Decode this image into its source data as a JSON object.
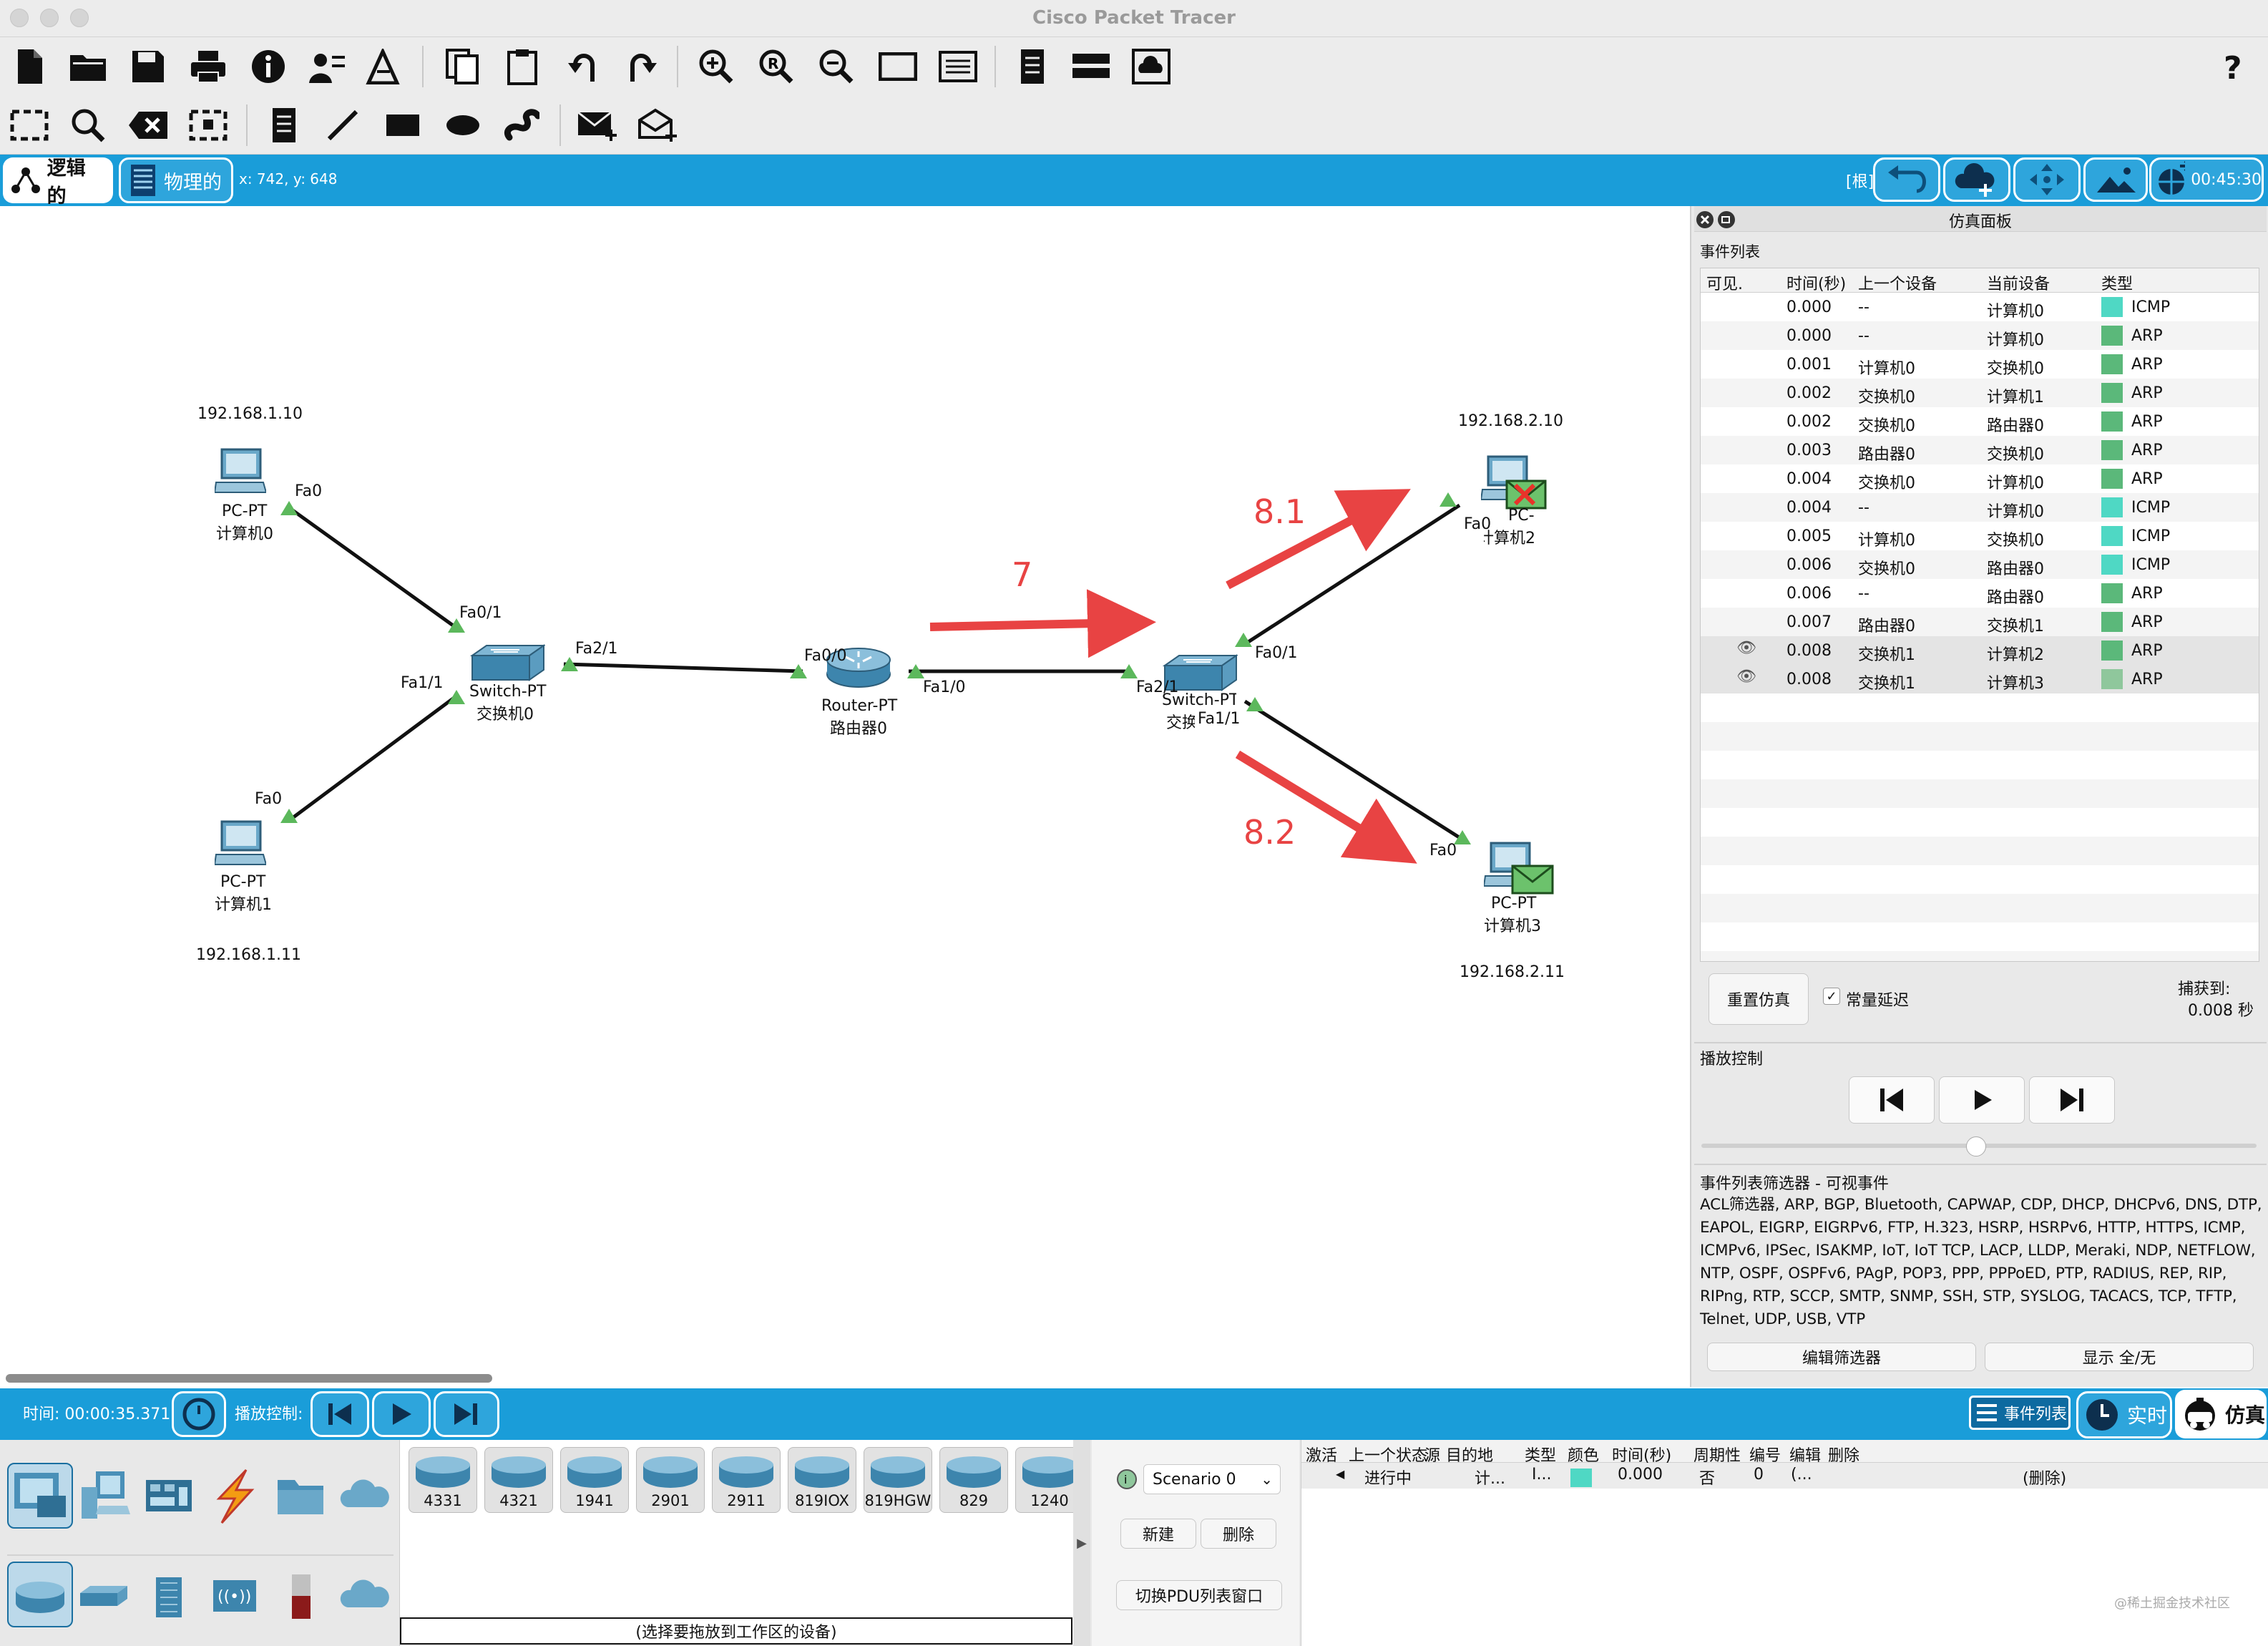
{
  "window": {
    "title": "Cisco Packet Tracer"
  },
  "tabs": {
    "logical": "逻辑的",
    "physical": "物理的",
    "coords": "x: 742, y: 648"
  },
  "topbar": {
    "root": "[根]",
    "clock": "00:45:30"
  },
  "topology": {
    "pc0": {
      "model": "PC-PT",
      "name": "计算机0",
      "ip": "192.168.1.10",
      "port": "Fa0"
    },
    "pc1": {
      "model": "PC-PT",
      "name": "计算机1",
      "ip": "192.168.1.11",
      "port": "Fa0"
    },
    "pc2": {
      "model": "PC-PT",
      "name": "计算机2",
      "ip": "192.168.2.10",
      "port": "Fa0"
    },
    "pc3": {
      "model": "PC-PT",
      "name": "计算机3",
      "ip": "192.168.2.11",
      "port": "Fa0"
    },
    "switch0": {
      "model": "Switch-PT",
      "name": "交换机0",
      "ports": [
        "Fa0/1",
        "Fa1/1",
        "Fa2/1"
      ]
    },
    "router0": {
      "model": "Router-PT",
      "name": "路由器0",
      "ports": [
        "Fa0/0",
        "Fa1/0"
      ]
    },
    "switch1": {
      "model": "Switch-PT",
      "name": "交换机1",
      "ports": [
        "Fa2/1",
        "Fa0/1",
        "Fa1/1"
      ]
    },
    "annotations": [
      "7",
      "8.1",
      "8.2"
    ]
  },
  "sim_panel": {
    "title": "仿真面板",
    "event_list_label": "事件列表",
    "headers": [
      "可见.",
      "时间(秒)",
      "上一个设备",
      "当前设备",
      "类型"
    ],
    "rows": [
      {
        "time": "0.000",
        "prev": "--",
        "cur": "计算机0",
        "type": "ICMP",
        "color": "#4fd8c4",
        "eye": false
      },
      {
        "time": "0.000",
        "prev": "--",
        "cur": "计算机0",
        "type": "ARP",
        "color": "#5bb87a",
        "eye": false
      },
      {
        "time": "0.001",
        "prev": "计算机0",
        "cur": "交换机0",
        "type": "ARP",
        "color": "#5bb87a",
        "eye": false
      },
      {
        "time": "0.002",
        "prev": "交换机0",
        "cur": "计算机1",
        "type": "ARP",
        "color": "#5bb87a",
        "eye": false
      },
      {
        "time": "0.002",
        "prev": "交换机0",
        "cur": "路由器0",
        "type": "ARP",
        "color": "#5bb87a",
        "eye": false
      },
      {
        "time": "0.003",
        "prev": "路由器0",
        "cur": "交换机0",
        "type": "ARP",
        "color": "#5bb87a",
        "eye": false
      },
      {
        "time": "0.004",
        "prev": "交换机0",
        "cur": "计算机0",
        "type": "ARP",
        "color": "#5bb87a",
        "eye": false
      },
      {
        "time": "0.004",
        "prev": "--",
        "cur": "计算机0",
        "type": "ICMP",
        "color": "#4fd8c4",
        "eye": false
      },
      {
        "time": "0.005",
        "prev": "计算机0",
        "cur": "交换机0",
        "type": "ICMP",
        "color": "#4fd8c4",
        "eye": false
      },
      {
        "time": "0.006",
        "prev": "交换机0",
        "cur": "路由器0",
        "type": "ICMP",
        "color": "#4fd8c4",
        "eye": false
      },
      {
        "time": "0.006",
        "prev": "--",
        "cur": "路由器0",
        "type": "ARP",
        "color": "#5bb87a",
        "eye": false
      },
      {
        "time": "0.007",
        "prev": "路由器0",
        "cur": "交换机1",
        "type": "ARP",
        "color": "#5bb87a",
        "eye": false
      },
      {
        "time": "0.008",
        "prev": "交换机1",
        "cur": "计算机2",
        "type": "ARP",
        "color": "#5bb87a",
        "eye": true
      },
      {
        "time": "0.008",
        "prev": "交换机1",
        "cur": "计算机3",
        "type": "ARP",
        "color": "#8fc79c",
        "eye": true
      }
    ],
    "reset_button": "重置仿真",
    "constant_delay": "常量延迟",
    "captured_label": "捕获到:",
    "captured_value": "0.008 秒",
    "playback_label": "播放控制",
    "filter_title": "事件列表筛选器 - 可视事件",
    "filter_text": "ACL筛选器, ARP, BGP, Bluetooth, CAPWAP, CDP, DHCP, DHCPv6, DNS, DTP, EAPOL, EIGRP, EIGRPv6, FTP, H.323, HSRP, HSRPv6, HTTP, HTTPS, ICMP, ICMPv6, IPSec, ISAKMP, IoT, IoT TCP, LACP, LLDP, Meraki, NDP, NETFLOW, NTP, OSPF, OSPFv6, PAgP, POP3, PPP, PPPoED, PTP, RADIUS, REP, RIP, RIPng, RTP, SCCP, SMTP, SNMP, SSH, STP, SYSLOG, TACACS, TCP, TFTP, Telnet, UDP, USB, VTP",
    "edit_filter": "编辑筛选器",
    "show_all": "显示 全/无"
  },
  "bottom": {
    "time_label": "时间: 00:00:35.371",
    "playback_label": "播放控制:",
    "event_list_btn": "事件列表",
    "realtime": "实时",
    "simulation": "仿真"
  },
  "device_palette": {
    "models": [
      "4331",
      "4321",
      "1941",
      "2901",
      "2911",
      "819IOX",
      "819HGW",
      "829",
      "1240"
    ],
    "hint": "(选择要拖放到工作区的设备)"
  },
  "scenario": {
    "selected": "Scenario 0",
    "new": "新建",
    "delete": "删除",
    "toggle": "切换PDU列表窗口"
  },
  "pdu_table": {
    "headers": [
      "激活",
      "上一个状态",
      "源",
      "目的地",
      "类型",
      "颜色",
      "时间(秒)",
      "周期性",
      "编号",
      "编辑",
      "删除"
    ],
    "row": {
      "state": "进行中",
      "src": "计...",
      "dst": "I...",
      "time": "0.000",
      "periodic": "否",
      "num": "0",
      "edit": "(...",
      "del": "(删除)"
    }
  },
  "watermark": "@稀土掘金技术社区",
  "colors": {
    "accent": "#1a9dd9",
    "arrow": "#e84343",
    "port_indicator": "#5cb85c"
  }
}
